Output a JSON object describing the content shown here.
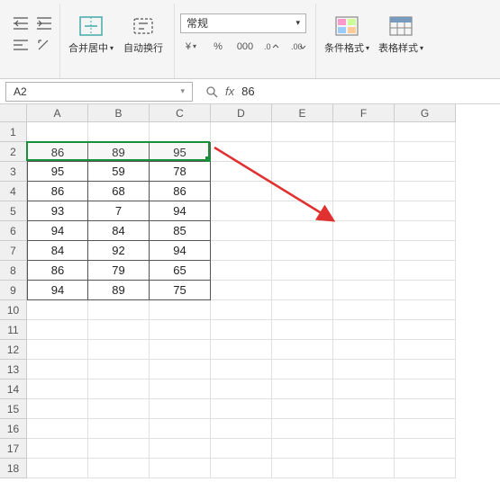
{
  "ribbon": {
    "merge_label": "合并居中",
    "wrap_label": "自动换行",
    "number_format": "常规",
    "cond_fmt_label": "条件格式",
    "table_style_label": "表格样式"
  },
  "name_box": {
    "value": "A2"
  },
  "formula_bar": {
    "value": "86"
  },
  "columns": [
    "A",
    "B",
    "C",
    "D",
    "E",
    "F",
    "G"
  ],
  "rows": [
    "1",
    "2",
    "3",
    "4",
    "5",
    "6",
    "7",
    "8",
    "9",
    "10",
    "11",
    "12",
    "13",
    "14",
    "15",
    "16",
    "17",
    "18"
  ],
  "grid": [
    [
      "",
      "",
      "",
      "",
      "",
      "",
      ""
    ],
    [
      "86",
      "89",
      "95",
      "",
      "",
      "",
      ""
    ],
    [
      "95",
      "59",
      "78",
      "",
      "",
      "",
      ""
    ],
    [
      "86",
      "68",
      "86",
      "",
      "",
      "",
      ""
    ],
    [
      "93",
      "7",
      "94",
      "",
      "",
      "",
      ""
    ],
    [
      "94",
      "84",
      "85",
      "",
      "",
      "",
      ""
    ],
    [
      "84",
      "92",
      "94",
      "",
      "",
      "",
      ""
    ],
    [
      "86",
      "79",
      "65",
      "",
      "",
      "",
      ""
    ],
    [
      "94",
      "89",
      "75",
      "",
      "",
      "",
      ""
    ],
    [
      "",
      "",
      "",
      "",
      "",
      "",
      ""
    ],
    [
      "",
      "",
      "",
      "",
      "",
      "",
      ""
    ],
    [
      "",
      "",
      "",
      "",
      "",
      "",
      ""
    ],
    [
      "",
      "",
      "",
      "",
      "",
      "",
      ""
    ],
    [
      "",
      "",
      "",
      "",
      "",
      "",
      ""
    ],
    [
      "",
      "",
      "",
      "",
      "",
      "",
      ""
    ],
    [
      "",
      "",
      "",
      "",
      "",
      "",
      ""
    ],
    [
      "",
      "",
      "",
      "",
      "",
      "",
      ""
    ],
    [
      "",
      "",
      "",
      "",
      "",
      "",
      ""
    ]
  ],
  "data_region": {
    "rowStart": 1,
    "rowEnd": 8,
    "colStart": 0,
    "colEnd": 2
  },
  "selection": {
    "row": 1,
    "colStart": 0,
    "colEnd": 2
  },
  "chart_data": {
    "type": "table",
    "columns": [
      "A",
      "B",
      "C"
    ],
    "rows": [
      [
        86,
        89,
        95
      ],
      [
        95,
        59,
        78
      ],
      [
        86,
        68,
        86
      ],
      [
        93,
        7,
        94
      ],
      [
        94,
        84,
        85
      ],
      [
        84,
        92,
        94
      ],
      [
        86,
        79,
        65
      ],
      [
        94,
        89,
        75
      ]
    ]
  }
}
